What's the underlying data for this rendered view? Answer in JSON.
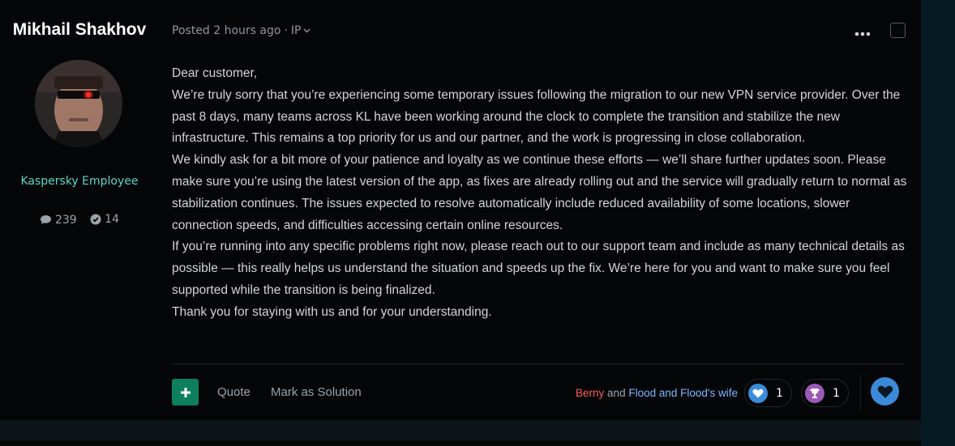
{
  "author": {
    "name": "Mikhail Shakhov",
    "role": "Kaspersky Employee",
    "posts_count": "239",
    "solutions_count": "14"
  },
  "post": {
    "posted_label": "Posted 2 hours ago",
    "separator": "·",
    "ip_label": "IP",
    "paragraphs": [
      "Dear customer,",
      "We’re truly sorry that you’re experiencing some temporary issues following the migration to our new VPN service provider. Over the past 8 days, many teams across KL have been working around the clock to complete the transition and stabilize the new infrastructure. This remains a top priority for us and our partner, and the work is progressing in close collaboration.",
      "We kindly ask for a bit more of your patience and loyalty as we continue these efforts — we’ll share further updates soon. Please make sure you’re using the latest version of the app, as fixes are already rolling out and the service will gradually return to normal as stabilization continues. The issues expected to resolve automatically include reduced availability of some locations, slower connection speeds, and difficulties accessing certain online resources.",
      "If you’re running into any specific problems right now, please reach out to our support team and include as many technical details as possible — this really helps us understand the situation and speeds up the fix. We’re here for you and want to make sure you feel supported while the transition is being finalized.",
      "Thank you for staying with us and for your understanding."
    ]
  },
  "footer": {
    "quote_label": "Quote",
    "solution_label": "Mark as Solution",
    "reacted_user1": "Berny",
    "reacted_and": "and",
    "reacted_user2": "Flood and Flood's wife",
    "like_count": "1",
    "trophy_count": "1"
  },
  "colors": {
    "accent_green": "#0d7f5d",
    "role_color": "#5ad6c9",
    "user1_color": "#ff5a5a",
    "user2_color": "#7fb6ff",
    "react_blue": "#3b8bd9",
    "trophy_purple": "#9b59b6"
  },
  "icons": {
    "comments": "comment-icon",
    "solutions": "check-circle-icon",
    "menu": "ellipsis-icon",
    "ip_dropdown": "chevron-down-icon",
    "plus": "plus-icon",
    "like": "heart-icon",
    "trophy": "trophy-icon",
    "react": "heart-icon"
  }
}
